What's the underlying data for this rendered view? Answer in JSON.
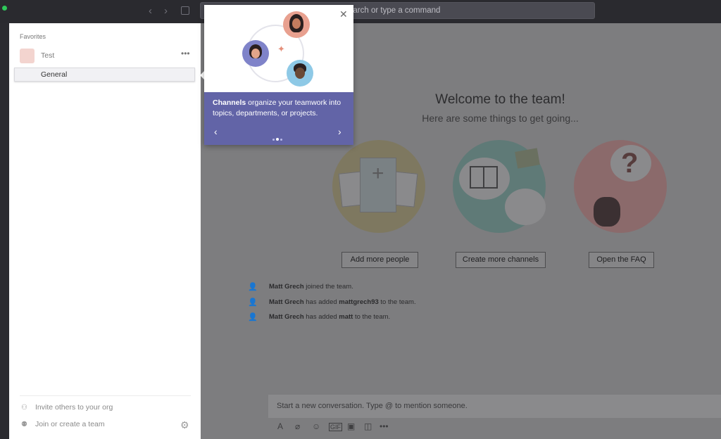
{
  "titlebar": {
    "back_icon": "chevron-left-icon",
    "forward_icon": "chevron-right-icon",
    "compose_icon": "compose-icon",
    "command_bar_placeholder": "earch or type a command"
  },
  "sidebar": {
    "section_label": "Favorites",
    "team": {
      "name": "Test",
      "more_label": "•••"
    },
    "channel": {
      "name": "General"
    },
    "footer": {
      "invite_label": "Invite others to your org",
      "join_label": "Join or create a team",
      "settings_icon": "gear-icon"
    }
  },
  "popover": {
    "close_label": "✕",
    "highlight": "Channels",
    "body": " organize your teamwork into topics, departments, or projects.",
    "prev_label": "‹",
    "next_label": "›",
    "current_dot": 2,
    "total_dots": 3,
    "accent_color": "#6264a7"
  },
  "welcome": {
    "title": "Welcome to the team!",
    "subtitle": "Here are some things to get going...",
    "actions": [
      {
        "label": "Add more people"
      },
      {
        "label": "Create more channels"
      },
      {
        "label": "Open the FAQ"
      }
    ]
  },
  "activity": [
    {
      "actor": "Matt Grech",
      "text": " joined the team.",
      "object": "",
      "suffix": ""
    },
    {
      "actor": "Matt Grech",
      "text": " has added ",
      "object": "mattgrech93",
      "suffix": " to the team."
    },
    {
      "actor": "Matt Grech",
      "text": " has added ",
      "object": "matt",
      "suffix": " to the team."
    }
  ],
  "composer": {
    "placeholder": "Start a new conversation. Type @ to mention someone.",
    "tools": [
      "format-icon",
      "attach-icon",
      "emoji-icon",
      "gif-icon",
      "sticker-icon",
      "meet-icon",
      "more-icon"
    ]
  }
}
